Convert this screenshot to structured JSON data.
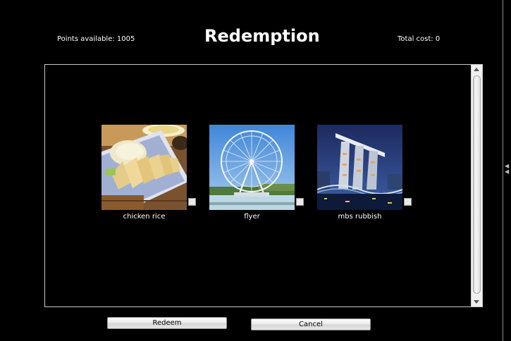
{
  "header": {
    "points_label": "Points available: 1005",
    "title": "Redemption",
    "total_label": "Total cost: 0"
  },
  "items": [
    {
      "caption": "chicken rice",
      "image": "chicken-rice-photo",
      "checked": false
    },
    {
      "caption": "flyer",
      "image": "singapore-flyer-photo",
      "checked": false
    },
    {
      "caption": "mbs rubbish",
      "image": "marina-bay-sands-photo",
      "checked": false
    }
  ],
  "buttons": {
    "redeem": "Redeem",
    "cancel": "Cancel"
  },
  "colors": {
    "background": "#000000",
    "text": "#ffffff",
    "panel_border": "#c9c9c9"
  }
}
